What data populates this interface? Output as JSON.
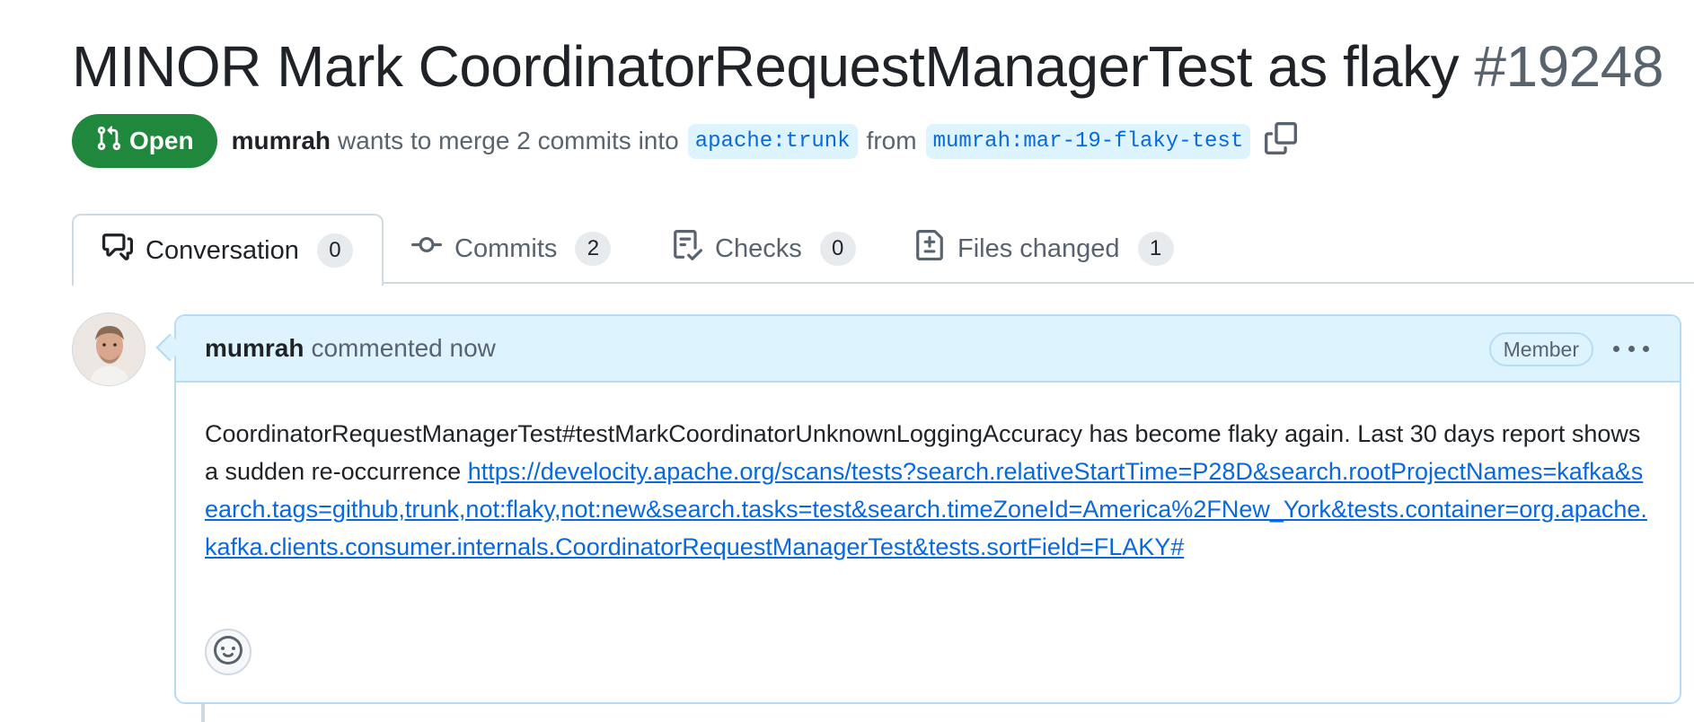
{
  "pr": {
    "title": "MINOR Mark CoordinatorRequestManagerTest as flaky",
    "number": "#19248",
    "state": "Open",
    "author": "mumrah",
    "status_text": "wants to merge 2 commits into",
    "base_branch": "apache:trunk",
    "from_text": "from",
    "head_branch": "mumrah:mar-19-flaky-test"
  },
  "tabs": [
    {
      "label": "Conversation",
      "count": "0",
      "icon": "comment-discussion-icon",
      "active": true
    },
    {
      "label": "Commits",
      "count": "2",
      "icon": "git-commit-icon",
      "active": false
    },
    {
      "label": "Checks",
      "count": "0",
      "icon": "checklist-icon",
      "active": false
    },
    {
      "label": "Files changed",
      "count": "1",
      "icon": "file-diff-icon",
      "active": false
    }
  ],
  "comment": {
    "author": "mumrah",
    "meta": "commented now",
    "role": "Member",
    "text": "CoordinatorRequestManagerTest#testMarkCoordinatorUnknownLoggingAccuracy has become flaky again. Last 30 days report shows a sudden re-occurrence",
    "link": "https://develocity.apache.org/scans/tests?search.relativeStartTime=P28D&search.rootProjectNames=kafka&search.tags=github,trunk,not:flaky,not:new&search.tasks=test&search.timeZoneId=America%2FNew_York&tests.container=org.apache.kafka.clients.consumer.internals.CoordinatorRequestManagerTest&tests.sortField=FLAKY#"
  },
  "colors": {
    "open_green": "#1f883d",
    "link_blue": "#0969da",
    "header_blue": "#ddf4ff"
  }
}
